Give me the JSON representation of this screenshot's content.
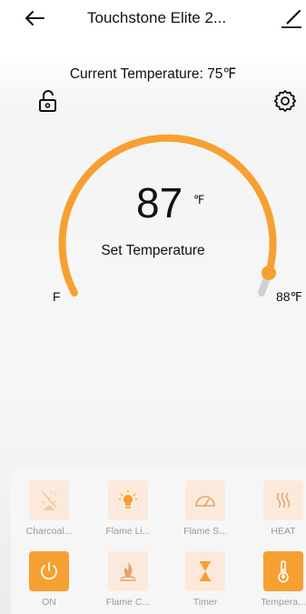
{
  "header": {
    "title": "Touchstone Elite 2..."
  },
  "status": {
    "current_temperature": "Current Temperature: 75℉"
  },
  "dial": {
    "set_value": "87",
    "set_unit": "℉",
    "set_label": "Set Temperature",
    "min_label": "F",
    "max_label": "88℉",
    "accent_color": "#f7a032",
    "track_color": "#d0d0d0"
  },
  "controls": [
    {
      "label": "Charcoal...",
      "icon": "charcoal-icon",
      "active": false
    },
    {
      "label": "Flame Li...",
      "icon": "lightbulb-icon",
      "active": false
    },
    {
      "label": "Flame S...",
      "icon": "speedometer-icon",
      "active": false
    },
    {
      "label": "HEAT",
      "icon": "heat-waves-icon",
      "active": false
    },
    {
      "label": "ON",
      "icon": "power-icon",
      "active": true
    },
    {
      "label": "Flame C...",
      "icon": "flame-color-icon",
      "active": false
    },
    {
      "label": "Timer",
      "icon": "hourglass-icon",
      "active": false
    },
    {
      "label": "Tempera...",
      "icon": "thermometer-icon",
      "active": true
    }
  ]
}
